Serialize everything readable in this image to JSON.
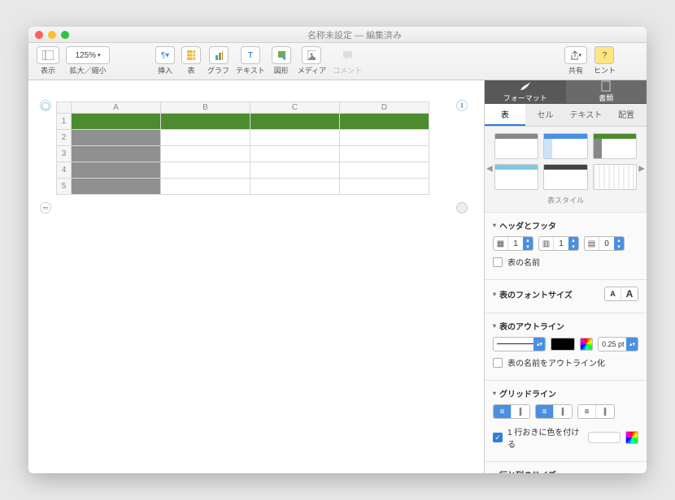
{
  "window": {
    "title": "名称未設定",
    "subtitle": "編集済み"
  },
  "toolbar": {
    "view": "表示",
    "zoom_value": "125%",
    "zoom_label": "拡大／縮小",
    "insert": "挿入",
    "table": "表",
    "chart": "グラフ",
    "text": "テキスト",
    "shape": "図形",
    "media": "メディア",
    "comment": "コメント",
    "share": "共有",
    "hint": "ヒント",
    "format": "フォーマット",
    "document": "書類"
  },
  "table": {
    "columns": [
      "A",
      "B",
      "C",
      "D"
    ],
    "rows": [
      "1",
      "2",
      "3",
      "4",
      "5"
    ]
  },
  "inspector": {
    "tabs": {
      "table": "表",
      "cell": "セル",
      "text": "テキスト",
      "arrange": "配置"
    },
    "styles_label": "表スタイル",
    "sections": {
      "header_footer": "ヘッダとフッタ",
      "hf_rows": "1",
      "hf_cols": "1",
      "hf_footer": "0",
      "table_name": "表の名前",
      "font_size": "表のフォントサイズ",
      "outline": "表のアウトライン",
      "outline_pt": "0.25 pt",
      "outline_name": "表の名前をアウトライン化",
      "gridlines": "グリッドライン",
      "alt_rows": "1 行おきに色を付ける",
      "row_col_size": "行と列のサイズ"
    }
  }
}
